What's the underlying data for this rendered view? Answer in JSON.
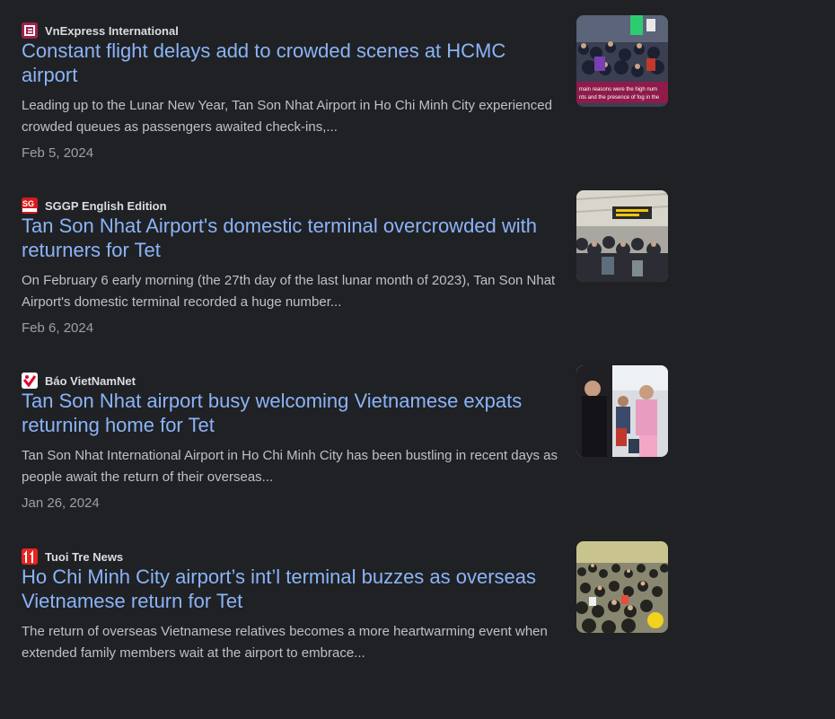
{
  "articles": [
    {
      "source": "VnExpress International",
      "icon": "vnexpress-logo-icon",
      "icon_color": "#9f224e",
      "headline": "Constant flight delays add to crowded scenes at HCMC airport",
      "snippet": "Leading up to the Lunar New Year, Tan Son Nhat Airport in Ho Chi Minh City experienced crowded queues as passengers awaited check-ins,...",
      "date": "Feb 5, 2024",
      "thumb_caption_1": "main reasons were the high num",
      "thumb_caption_2": "nts and the presence of fog in the"
    },
    {
      "source": "SGGP English Edition",
      "icon": "sggp-logo-icon",
      "icon_color": "#d71920",
      "headline": "Tan Son Nhat Airport's domestic terminal overcrowded with returners for Tet",
      "snippet": "On February 6 early morning (the 27th day of the last lunar month of 2023), Tan Son Nhat Airport's domestic terminal recorded a huge number...",
      "date": "Feb 6, 2024"
    },
    {
      "source": "Báo VietNamNet",
      "icon": "vietnamnet-logo-icon",
      "icon_color": "#e4022d",
      "headline": "Tan Son Nhat airport busy welcoming Vietnamese expats returning home for Tet",
      "snippet": "Tan Son Nhat International Airport in Ho Chi Minh City has been bustling in recent days as people await the return of their overseas...",
      "date": "Jan 26, 2024"
    },
    {
      "source": "Tuoi Tre News",
      "icon": "tuoitre-logo-icon",
      "icon_color": "#e52421",
      "headline": "Ho Chi Minh City airport’s int’l terminal buzzes as overseas Vietnamese return for Tet",
      "snippet": "The return of overseas Vietnamese relatives becomes a more heartwarming event when extended family members wait at the airport to embrace...",
      "date": ""
    }
  ]
}
